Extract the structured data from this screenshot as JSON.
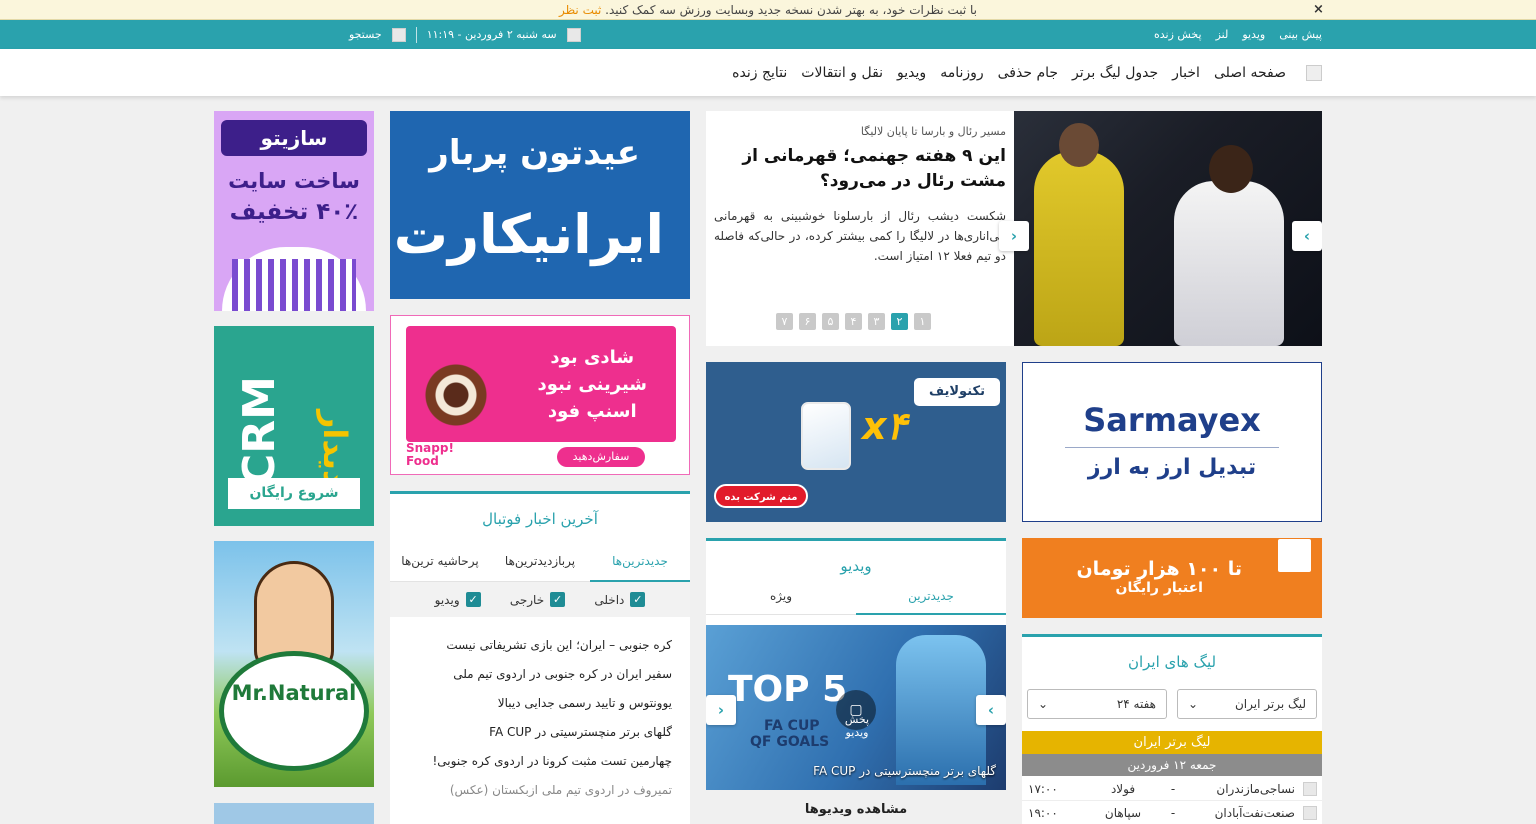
{
  "notice": {
    "text": "با ثبت نظرات خود، به بهتر شدن نسخه جدید وبسایت ورزش سه کمک کنید.",
    "cta": "ثبت نظر",
    "close": "×"
  },
  "topstrip": {
    "links": [
      "پیش بینی",
      "ویدیو",
      "لنز",
      "پخش زنده"
    ],
    "date": "سه شنبه ۲ فروردین - ۱۱:۱۹",
    "search": "جستجو"
  },
  "nav": {
    "items": [
      "صفحه اصلی",
      "اخبار",
      "جدول لیگ برتر",
      "جام حذفی",
      "روزنامه",
      "ویدیو",
      "نقل و انتقالات",
      "نتایج زنده"
    ]
  },
  "slider": {
    "kicker": "مسیر رئال و بارسا تا پایان لالیگا",
    "title": "این ۹ هفته جهنمی؛ قهرمانی از مشت رئال در می‌رود؟",
    "lead": "شکست دیشب رئال از بارسلونا خوشبینی به قهرمانی آبی‌اناری‌ها در لالیگا را کمی بیشتر کرده، در حالی‌که فاصله دو تیم فعلا ۱۲ امتیاز است.",
    "pages": [
      "۱",
      "۲",
      "۳",
      "۴",
      "۵",
      "۶",
      "۷"
    ],
    "active_page": 1
  },
  "ads": {
    "irancart": {
      "line1": "عیدتون پربار",
      "line2": "ایرانیکارت"
    },
    "sazito": {
      "brand": "سازیتو",
      "line1": "ساخت سایت",
      "line2": "۴۰٪ تخفیف"
    },
    "snappfood": {
      "line1": "شادی بود",
      "line2": "شیرینی نبود",
      "line3": "اسنپ فود",
      "cta": "سفارش‌دهید",
      "brand": "Snapp! Food"
    },
    "technolife": {
      "brand": "تکنولایف",
      "multiplier": "x۴",
      "cta": "منم شرکت بده"
    },
    "sarmayex": {
      "brand": "Sarmayex",
      "tagline": "تبدیل ارز به ارز"
    },
    "didar": {
      "crm": "CRM",
      "brand": "دیدار",
      "cta": "شروع رایگان"
    },
    "filimo": {
      "line1": "تا ۱۰۰ هزار تومان",
      "line2": "اعتبار رایگان"
    },
    "natural": {
      "brand": "Mr.Natural"
    }
  },
  "news": {
    "title": "آخرین اخبار فوتبال",
    "tabs": [
      "جدیدترین‌ها",
      "پربازدیدترین‌ها",
      "پرحاشیه ترین‌ها"
    ],
    "filters": [
      "داخلی",
      "خارجی",
      "ویدیو"
    ],
    "items": [
      "کره جنوبی – ایران؛ این بازی تشریفاتی نیست",
      "سفیر ایران در کره جنوبی در اردوی تیم ملی",
      "یوونتوس و تایید رسمی جدایی دیبالا",
      "گلهای برتر منچسترسیتی در FA CUP",
      "چهارمین تست مثبت کرونا در اردوی کره جنوبی!",
      "تمیروف در اردوی تیم ملی ازبکستان (عکس)"
    ]
  },
  "video": {
    "title": "ویدیو",
    "tabs": [
      "جدیدترین",
      "ویژه"
    ],
    "caption": "گلهای برتر منچسترسیتی در FA CUP",
    "thumb_line1": "TOP 5",
    "thumb_line2": "FA CUP",
    "thumb_line3": "QF GOALS",
    "play": "پخش ویدیو",
    "more": "مشاهده ویدیوها"
  },
  "league": {
    "title": "لیگ های ایران",
    "select_league": "لیگ برتر ایران",
    "select_week": "هفته ۲۴",
    "band": "لیگ برتر ایران",
    "day": "جمعه ۱۲ فروردین",
    "matches": [
      {
        "home": "نساجی‌مازندران",
        "away": "فولاد",
        "time": "۱۷:۰۰"
      },
      {
        "home": "صنعت‌نفت‌آبادان",
        "away": "سپاهان",
        "time": "۱۹:۰۰"
      }
    ]
  },
  "colors": {
    "teal": "#2aa2ad",
    "tealDark": "#1f8c95",
    "gold": "#e6b400",
    "gray": "#8c8c8c"
  }
}
